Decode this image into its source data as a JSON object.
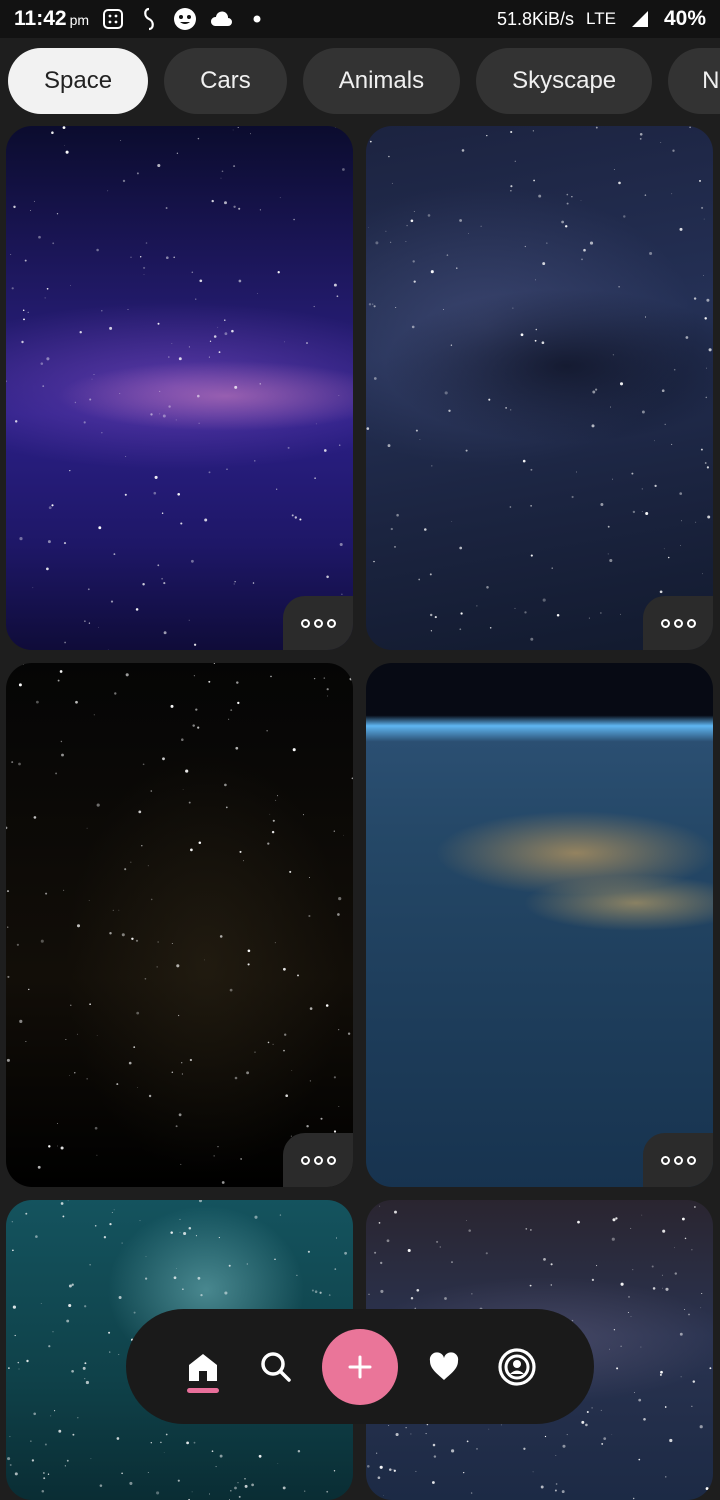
{
  "status_bar": {
    "time": "11:42",
    "ampm": "pm",
    "net_speed": "51.8KiB/s",
    "network": "LTE",
    "battery": "40%"
  },
  "categories": [
    {
      "label": "Space",
      "active": true
    },
    {
      "label": "Cars",
      "active": false
    },
    {
      "label": "Animals",
      "active": false
    },
    {
      "label": "Skyscape",
      "active": false
    },
    {
      "label": "Ne",
      "active": false
    }
  ],
  "wallpapers": [
    {
      "name": "milky-way-purple",
      "theme": "bg-milky"
    },
    {
      "name": "starfield-blue",
      "theme": "bg-blue"
    },
    {
      "name": "dark-night-sky",
      "theme": "bg-dark"
    },
    {
      "name": "earth-from-orbit",
      "theme": "bg-earth"
    },
    {
      "name": "teal-starry-sky",
      "theme": "bg-teal"
    },
    {
      "name": "dusk-milky-way",
      "theme": "bg-dusk"
    }
  ],
  "bottom_nav": {
    "items": [
      "home-icon",
      "search-icon",
      "add-icon",
      "heart-icon",
      "profile-icon"
    ],
    "active": "home-icon"
  },
  "colors": {
    "accent": "#ea7599",
    "chip_bg": "#333333",
    "chip_active_bg": "#f2f2f2",
    "background": "#1e1e1e"
  }
}
